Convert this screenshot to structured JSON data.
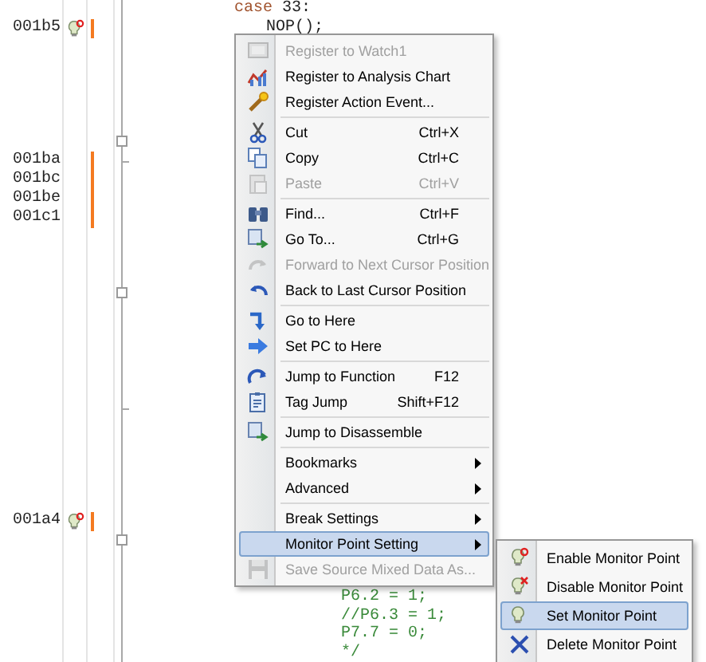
{
  "editor": {
    "lines": [
      {
        "monitor_point": false,
        "changed": false,
        "code": [
          {
            "text": "case",
            "kind": "keyword"
          },
          {
            "text": " 33:",
            "kind": "plain"
          }
        ]
      },
      {
        "address": "001b5",
        "monitor_point": true,
        "changed": true,
        "code": [
          {
            "text": "NOP();",
            "kind": "plain"
          }
        ]
      },
      {
        "address": "001ba",
        "monitor_point": false,
        "changed": true
      },
      {
        "address": "001bc",
        "monitor_point": false,
        "changed": true
      },
      {
        "address": "001be",
        "monitor_point": false,
        "changed": true
      },
      {
        "address": "001c1",
        "monitor_point": false,
        "changed": true
      },
      {
        "address": "001a4",
        "monitor_point": true,
        "changed": true
      },
      {
        "monitor_point": false,
        "changed": false,
        "code": [
          {
            "text": "P6.2 = 1;",
            "kind": "comment"
          }
        ]
      },
      {
        "monitor_point": false,
        "changed": false,
        "code": [
          {
            "text": "//P6.3 = 1;",
            "kind": "comment"
          }
        ]
      },
      {
        "monitor_point": false,
        "changed": false,
        "code": [
          {
            "text": "P7.7 = 0;",
            "kind": "comment"
          }
        ]
      },
      {
        "monitor_point": false,
        "changed": false,
        "code": [
          {
            "text": "*/",
            "kind": "comment"
          }
        ]
      }
    ]
  },
  "context_menu": {
    "items": [
      {
        "kind": "item",
        "label": "Register to Watch1",
        "disabled": true,
        "selected": false,
        "submenu": false
      },
      {
        "kind": "item",
        "label": "Register to Analysis Chart",
        "disabled": false,
        "selected": false,
        "submenu": false
      },
      {
        "kind": "item",
        "label": "Register Action Event...",
        "disabled": false,
        "selected": false,
        "submenu": false
      },
      {
        "kind": "separator"
      },
      {
        "kind": "item",
        "label": "Cut",
        "shortcut": "Ctrl+X",
        "disabled": false,
        "selected": false,
        "submenu": false
      },
      {
        "kind": "item",
        "label": "Copy",
        "shortcut": "Ctrl+C",
        "disabled": false,
        "selected": false,
        "submenu": false
      },
      {
        "kind": "item",
        "label": "Paste",
        "shortcut": "Ctrl+V",
        "disabled": true,
        "selected": false,
        "submenu": false
      },
      {
        "kind": "separator"
      },
      {
        "kind": "item",
        "label": "Find...",
        "shortcut": "Ctrl+F",
        "disabled": false,
        "selected": false,
        "submenu": false
      },
      {
        "kind": "item",
        "label": "Go To...",
        "shortcut": "Ctrl+G",
        "disabled": false,
        "selected": false,
        "submenu": false
      },
      {
        "kind": "item",
        "label": "Forward to Next Cursor Position",
        "disabled": true,
        "selected": false,
        "submenu": false
      },
      {
        "kind": "item",
        "label": "Back to Last Cursor Position",
        "disabled": false,
        "selected": false,
        "submenu": false
      },
      {
        "kind": "separator"
      },
      {
        "kind": "item",
        "label": "Go to Here",
        "disabled": false,
        "selected": false,
        "submenu": false
      },
      {
        "kind": "item",
        "label": "Set PC to Here",
        "disabled": false,
        "selected": false,
        "submenu": false
      },
      {
        "kind": "separator"
      },
      {
        "kind": "item",
        "label": "Jump to Function",
        "shortcut": "F12",
        "disabled": false,
        "selected": false,
        "submenu": false
      },
      {
        "kind": "item",
        "label": "Tag Jump",
        "shortcut": "Shift+F12",
        "disabled": false,
        "selected": false,
        "submenu": false
      },
      {
        "kind": "separator"
      },
      {
        "kind": "item",
        "label": "Jump to Disassemble",
        "disabled": false,
        "selected": false,
        "submenu": false
      },
      {
        "kind": "separator"
      },
      {
        "kind": "item",
        "label": "Bookmarks",
        "disabled": false,
        "selected": false,
        "submenu": true
      },
      {
        "kind": "item",
        "label": "Advanced",
        "disabled": false,
        "selected": false,
        "submenu": true
      },
      {
        "kind": "separator"
      },
      {
        "kind": "item",
        "label": "Break Settings",
        "disabled": false,
        "selected": false,
        "submenu": true
      },
      {
        "kind": "item",
        "label": "Monitor Point Setting",
        "disabled": false,
        "selected": true,
        "submenu": true
      },
      {
        "kind": "item",
        "label": "Save Source Mixed Data As...",
        "disabled": true,
        "selected": false,
        "submenu": false
      }
    ]
  },
  "submenu": {
    "items": [
      {
        "label": "Enable Monitor Point",
        "selected": false
      },
      {
        "label": "Disable Monitor Point",
        "selected": false
      },
      {
        "label": "Set Monitor Point",
        "selected": true
      },
      {
        "label": "Delete Monitor Point",
        "selected": false
      }
    ]
  }
}
